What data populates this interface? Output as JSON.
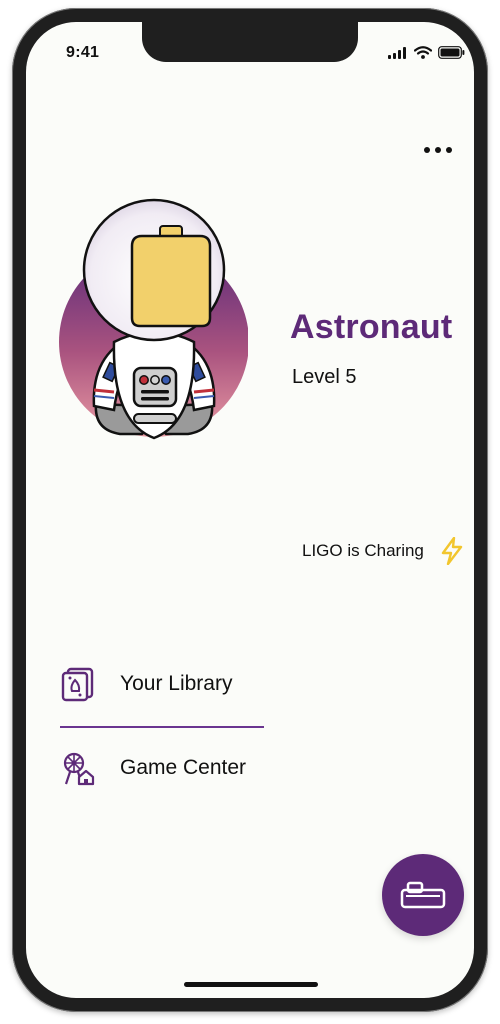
{
  "status_bar": {
    "time": "9:41",
    "icons": [
      "signal-icon",
      "wifi-icon",
      "battery-icon"
    ]
  },
  "header": {
    "menu_icon": "more-dots-icon"
  },
  "profile": {
    "avatar_icon": "astronaut-avatar",
    "name": "Astronaut",
    "level": "Level 5"
  },
  "device": {
    "status_text": "LIGO is Charing",
    "status_icon": "lightning-bolt-icon"
  },
  "menu": {
    "items": [
      {
        "label": "Your Library",
        "icon": "library-cards-icon"
      },
      {
        "label": "Game Center",
        "icon": "game-center-icon"
      }
    ]
  },
  "fab": {
    "icon": "keyboard-icon"
  },
  "colors": {
    "accent": "#5d2a78",
    "bolt": "#f2c62e",
    "background": "#fbfcf9"
  }
}
